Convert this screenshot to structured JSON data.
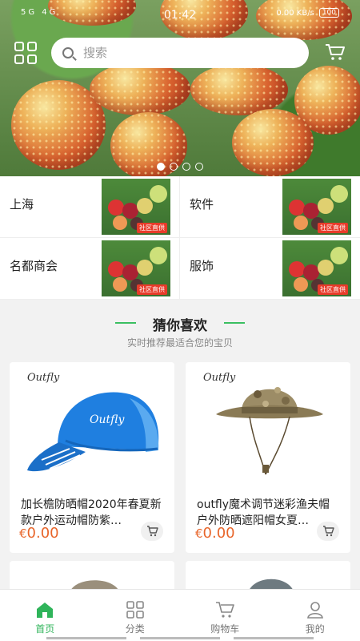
{
  "status_bar": {
    "signal": "5G 4G",
    "time": "01:42",
    "net_speed": "0.00 KB/s",
    "battery": "100"
  },
  "search": {
    "placeholder": "搜索"
  },
  "banner": {
    "slides": 4,
    "active_slide": 1
  },
  "categories": [
    {
      "label": "上海",
      "badge": "社区直供"
    },
    {
      "label": "软件",
      "badge": "社区直供"
    },
    {
      "label": "名都商会",
      "badge": "社区直供"
    },
    {
      "label": "服饰",
      "badge": "社区直供"
    }
  ],
  "guess": {
    "title": "猜你喜欢",
    "subtitle": "实时推荐最适合您的宝贝"
  },
  "products": [
    {
      "brand": "Outfly",
      "title": "加长檐防晒帽2020年春夏新款户外运动帽防紫…",
      "currency": "€",
      "price": "0.00"
    },
    {
      "brand": "Outfly",
      "title": "outfly魔术调节迷彩渔夫帽户外防晒遮阳帽女夏…",
      "currency": "€",
      "price": "0.00"
    }
  ],
  "tabbar": [
    {
      "label": "首页",
      "icon": "home-icon",
      "active": true
    },
    {
      "label": "分类",
      "icon": "category-grid-icon",
      "active": false
    },
    {
      "label": "购物车",
      "icon": "cart-icon",
      "active": false
    },
    {
      "label": "我的",
      "icon": "user-icon",
      "active": false
    }
  ],
  "colors": {
    "accent": "#2fb45a",
    "price": "#e8652a",
    "badge": "#e83b2a"
  }
}
